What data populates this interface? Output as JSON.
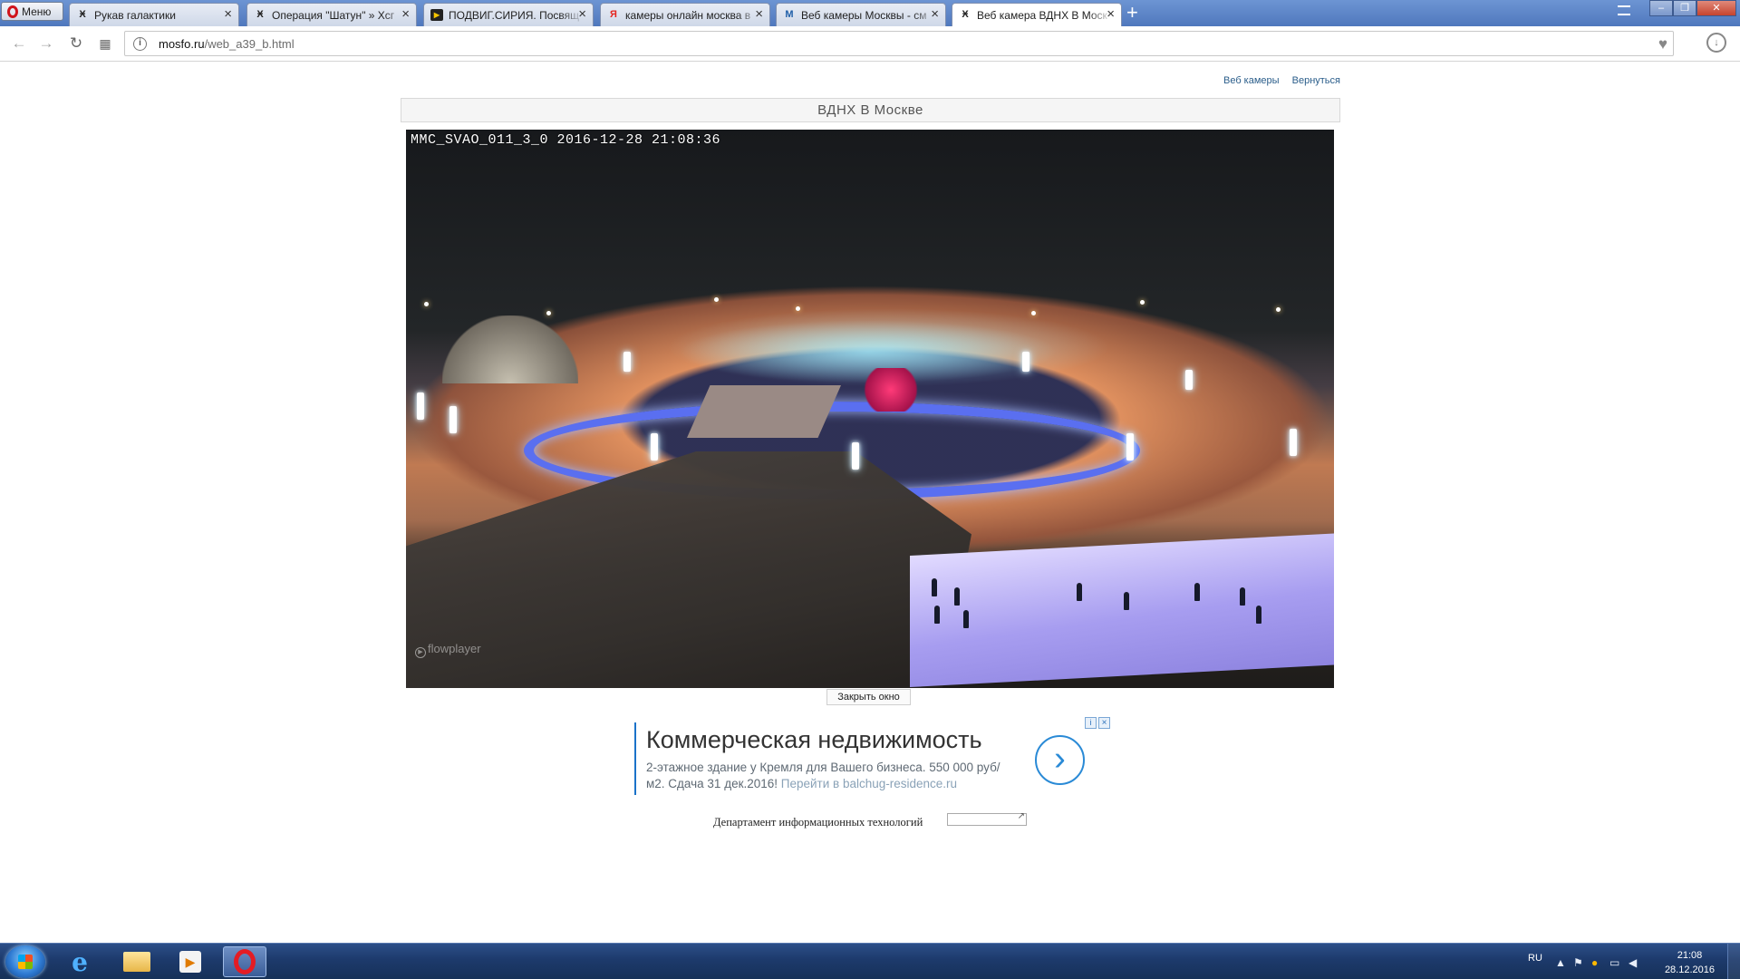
{
  "browser": {
    "menu_label": "Меню",
    "tabs": [
      {
        "title": "Рукав галактики",
        "favicon": "Ӿ",
        "active": false
      },
      {
        "title": "Операция \"Шатун\" » Хсг",
        "favicon": "Ӿ",
        "active": false
      },
      {
        "title": "ПОДВИГ.СИРИЯ. Посвящ",
        "favicon": "▶",
        "active": false
      },
      {
        "title": "камеры онлайн москва в",
        "favicon": "Я",
        "active": false
      },
      {
        "title": "Веб камеры Москвы - см",
        "favicon": "M",
        "active": false
      },
      {
        "title": "Веб камера ВДНХ В Моск",
        "favicon": "Ӿ",
        "active": true
      }
    ],
    "new_tab_label": "+",
    "url_host": "mosfo.ru",
    "url_path": "/web_a39_b.html"
  },
  "page": {
    "links": [
      "Веб камеры",
      "Вернуться"
    ],
    "title": "ВДНХ В Москве",
    "video": {
      "overlay": "MMC_SVAO_011_3_0 2016-12-28 21:08:36",
      "watermark": "flowplayer"
    },
    "close_button": "Закрыть окно",
    "ad": {
      "title": "Коммерческая недвижимость",
      "body": "2-этажное здание у Кремля для Вашего бизнеса. 550 000 руб/м2. Сдача 31 дек.2016!",
      "link": "Перейти в balchug-residence.ru"
    },
    "footer": "Департамент информационных технологий"
  },
  "taskbar": {
    "lang": "RU",
    "time": "21:08",
    "date": "28.12.2016"
  },
  "colors": {
    "titlebar": "#4f78bd",
    "ad_accent": "#2a8ad6",
    "opera_red": "#e41c24"
  }
}
